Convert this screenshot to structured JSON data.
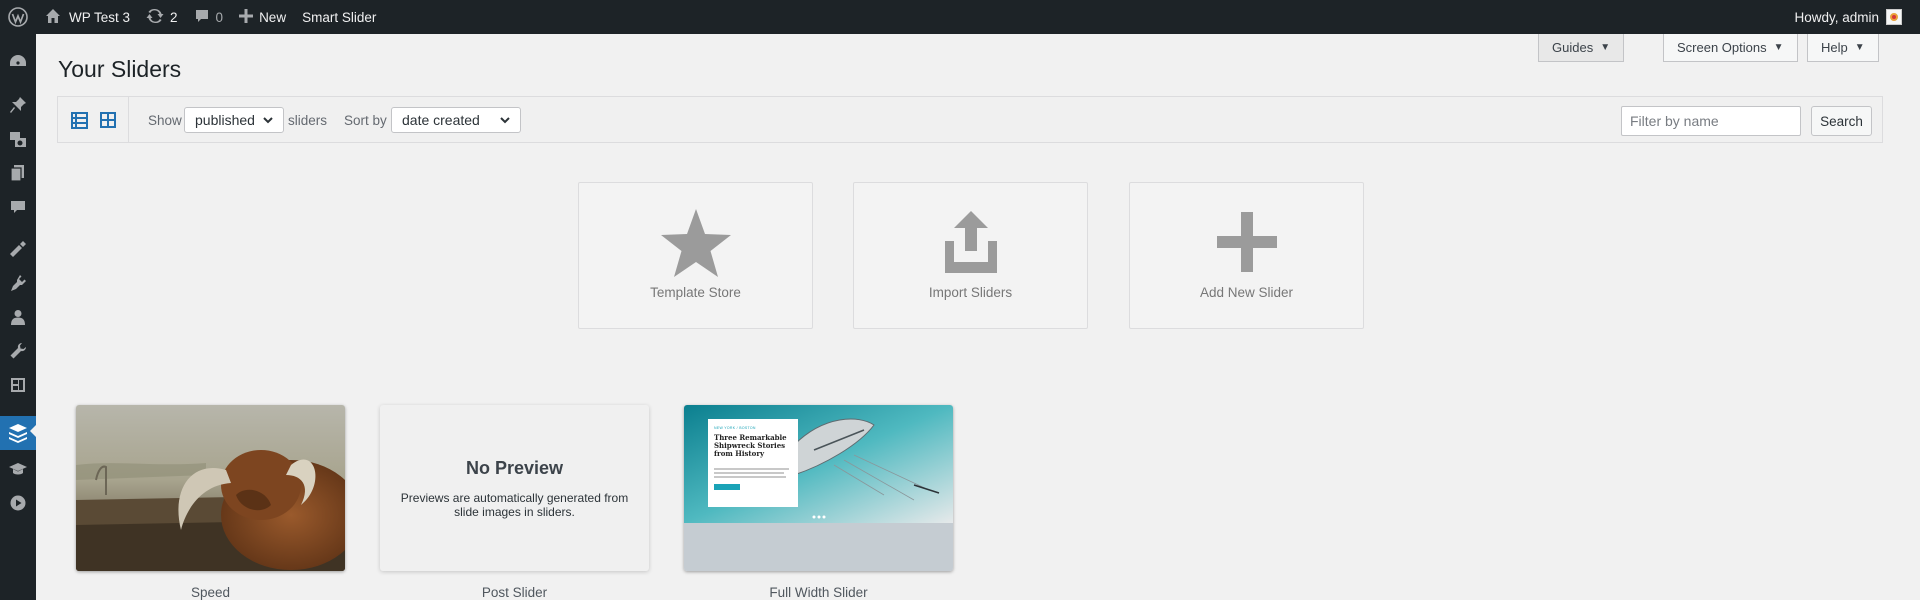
{
  "adminbar": {
    "site_name": "WP Test 3",
    "updates_count": "2",
    "comments_count": "0",
    "new_label": "New",
    "plugin_link": "Smart Slider",
    "greeting": "Howdy, admin"
  },
  "header": {
    "guides_label": "Guides",
    "screen_options_label": "Screen Options",
    "help_label": "Help",
    "title": "Your Sliders"
  },
  "toolbar": {
    "show_label": "Show",
    "status_value": "published",
    "sliders_label": "sliders",
    "sortby_label": "Sort by",
    "sort_value": "date created",
    "filter_placeholder": "Filter by name",
    "search_label": "Search"
  },
  "actions": [
    {
      "label": "Template Store",
      "icon": "star-icon"
    },
    {
      "label": "Import Sliders",
      "icon": "upload-icon"
    },
    {
      "label": "Add New Slider",
      "icon": "plus-icon"
    }
  ],
  "sliders": [
    {
      "name": "Speed",
      "preview": "highland-cow-image"
    },
    {
      "name": "Post Slider",
      "preview_title": "No Preview",
      "preview_text": "Previews are automatically generated from slide images in sliders."
    },
    {
      "name": "Full Width Slider",
      "preview": "shipwreck-image",
      "preview_kicker": "NEW YORK / BOSTON",
      "preview_heading": "Three Remarkable Shipwreck Stories from History"
    }
  ],
  "sidebar_icons": [
    "dashboard-icon",
    "pin-icon",
    "media-icon",
    "pages-icon",
    "comments-icon",
    "appearance-icon",
    "plugins-icon",
    "users-icon",
    "tools-icon",
    "settings-icon",
    "smart-slider-icon",
    "education-icon",
    "play-icon"
  ],
  "colors": {
    "adminbar_bg": "#1d2327",
    "accent": "#2271b1",
    "page_bg": "#f1f1f1"
  }
}
